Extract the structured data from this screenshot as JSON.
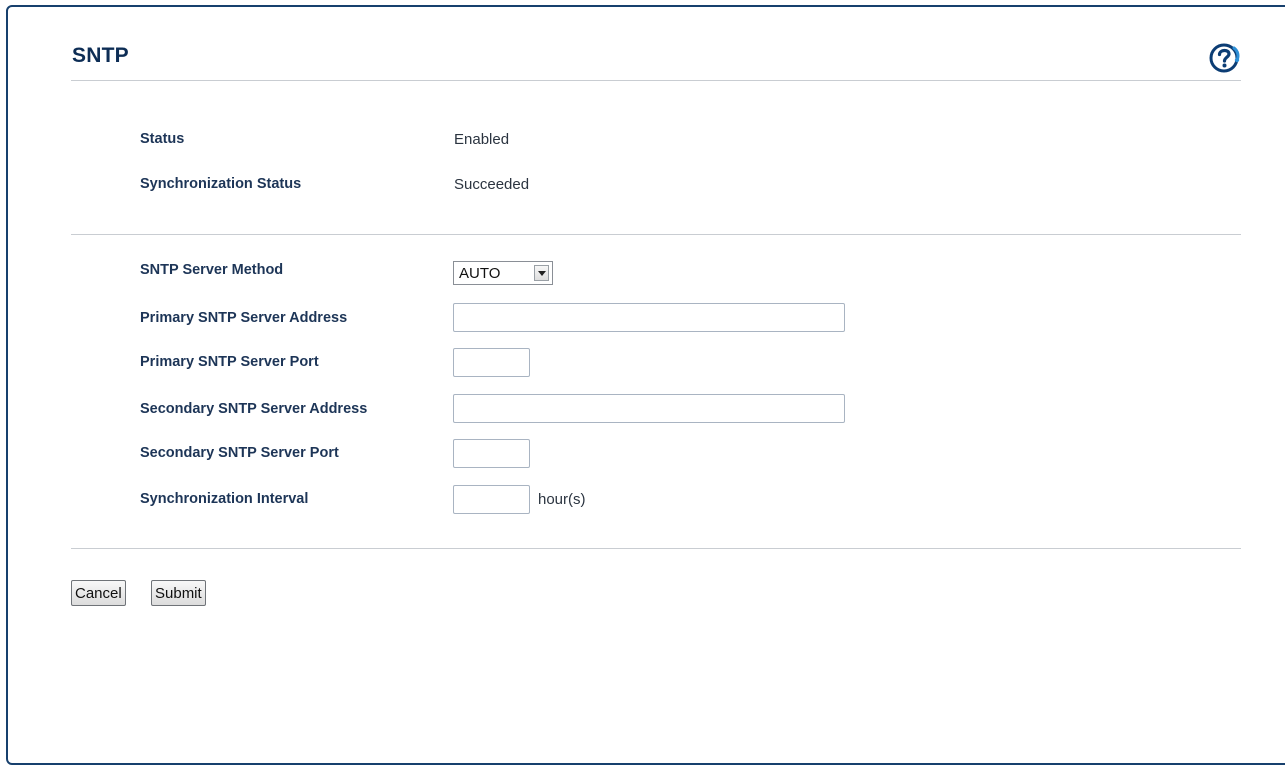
{
  "page": {
    "title": "SNTP",
    "help_icon": "help-question-icon"
  },
  "status_section": {
    "status_label": "Status",
    "status_value": "Enabled",
    "sync_status_label": "Synchronization Status",
    "sync_status_value": "Succeeded"
  },
  "settings": {
    "server_method_label": "SNTP Server Method",
    "server_method_value": "AUTO",
    "primary_address_label": "Primary SNTP Server Address",
    "primary_address_value": "",
    "primary_port_label": "Primary SNTP Server Port",
    "primary_port_value": "",
    "secondary_address_label": "Secondary SNTP Server Address",
    "secondary_address_value": "",
    "secondary_port_label": "Secondary SNTP Server Port",
    "secondary_port_value": "",
    "sync_interval_label": "Synchronization Interval",
    "sync_interval_value": "",
    "sync_interval_unit": "hour(s)"
  },
  "buttons": {
    "cancel_label": "Cancel",
    "submit_label": "Submit"
  },
  "colors": {
    "frame_border": "#17406d",
    "title": "#0d2d55",
    "help_icon": "#0c3d74",
    "help_icon_accent": "#2d8fd6"
  }
}
